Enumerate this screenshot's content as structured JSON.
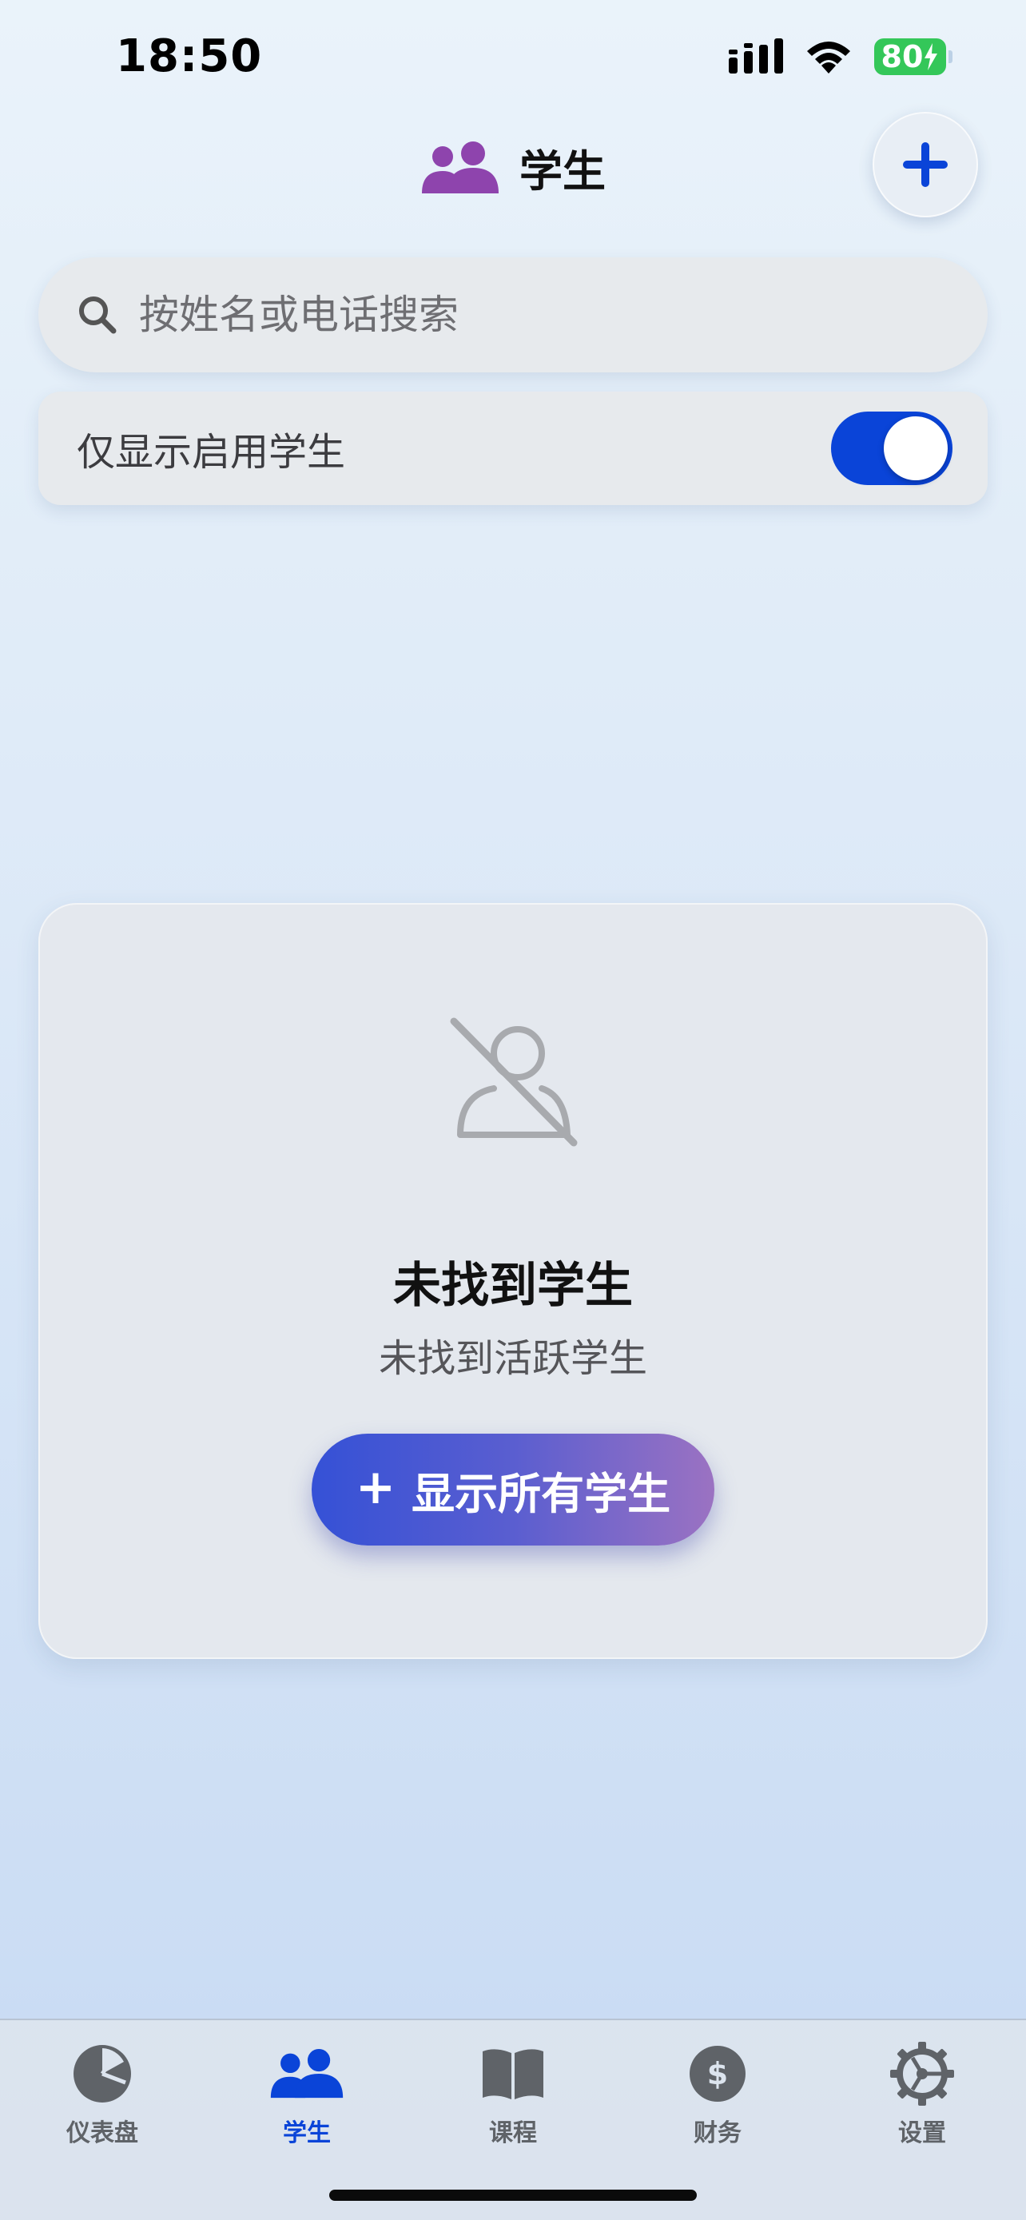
{
  "status_bar": {
    "time": "18:50",
    "battery": "80"
  },
  "header": {
    "title": "学生"
  },
  "search": {
    "placeholder": "按姓名或电话搜索"
  },
  "filter": {
    "label": "仅显示启用学生",
    "enabled": true
  },
  "empty_state": {
    "title": "未找到学生",
    "subtitle": "未找到活跃学生",
    "button_label": "显示所有学生"
  },
  "tabs": [
    {
      "label": "仪表盘",
      "icon": "pie-chart-icon"
    },
    {
      "label": "学生",
      "icon": "people-icon",
      "active": true
    },
    {
      "label": "课程",
      "icon": "book-icon"
    },
    {
      "label": "财务",
      "icon": "dollar-icon"
    },
    {
      "label": "设置",
      "icon": "gear-icon"
    }
  ],
  "colors": {
    "accent": "#0a44d8",
    "header_icon": "#8e44ad",
    "battery": "#34c759",
    "tab_inactive": "#5f6368"
  }
}
